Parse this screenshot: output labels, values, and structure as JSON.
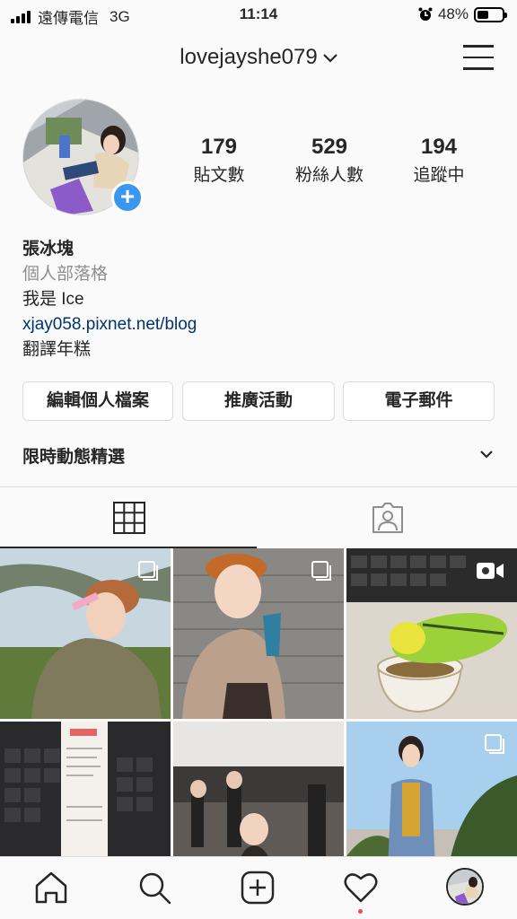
{
  "status_bar": {
    "carrier": "遠傳電信",
    "network": "3G",
    "time": "11:14",
    "battery_percent": "48%",
    "battery_level": 0.48
  },
  "header": {
    "username": "lovejayshe079"
  },
  "stats": [
    {
      "num": "179",
      "label": "貼文數"
    },
    {
      "num": "529",
      "label": "粉絲人數"
    },
    {
      "num": "194",
      "label": "追蹤中"
    }
  ],
  "bio": {
    "name": "張冰塊",
    "category": "個人部落格",
    "line1": "我是 Ice",
    "link": "xjay058.pixnet.net/blog",
    "line2": "翻譯年糕"
  },
  "buttons": {
    "edit_profile": "編輯個人檔案",
    "promotions": "推廣活動",
    "email": "電子郵件"
  },
  "highlights": {
    "label": "限時動態精選"
  },
  "colors": {
    "accent_blue": "#3897f0",
    "link": "#003569",
    "notification": "#ed4956"
  },
  "grid_icons": [
    "multi-photo",
    "multi-photo",
    "video",
    "",
    "",
    "multi-photo"
  ]
}
